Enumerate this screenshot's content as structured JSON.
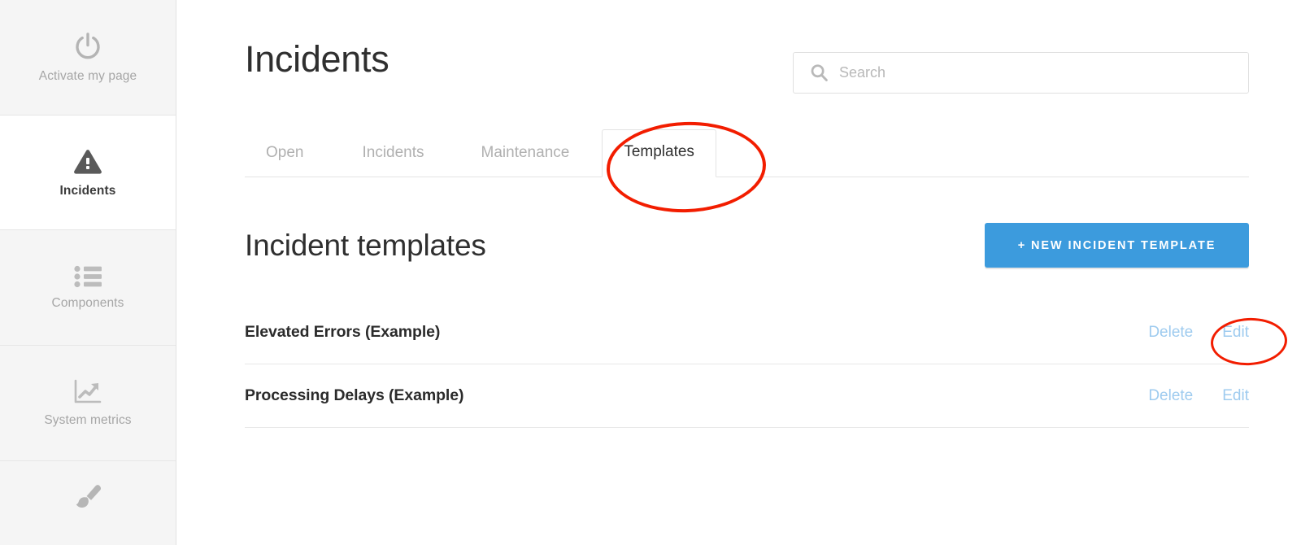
{
  "sidebar": {
    "items": [
      {
        "label": "Activate my page",
        "icon": "power-icon",
        "key": "activate",
        "active": false
      },
      {
        "label": "Incidents",
        "icon": "warning-triangle-icon",
        "key": "incidents",
        "active": true
      },
      {
        "label": "Components",
        "icon": "list-icon",
        "key": "components",
        "active": false
      },
      {
        "label": "System metrics",
        "icon": "chart-line-icon",
        "key": "metrics",
        "active": false
      },
      {
        "label": "",
        "icon": "paintbrush-icon",
        "key": "customize",
        "active": false
      }
    ]
  },
  "header": {
    "title": "Incidents"
  },
  "search": {
    "placeholder": "Search",
    "value": "",
    "icon": "search-icon"
  },
  "tabs": [
    {
      "label": "Open",
      "active": false
    },
    {
      "label": "Incidents",
      "active": false
    },
    {
      "label": "Maintenance",
      "active": false
    },
    {
      "label": "Templates",
      "active": true
    }
  ],
  "section": {
    "title": "Incident templates",
    "new_button_label": "+ New incident template"
  },
  "templates": {
    "rows": [
      {
        "name": "Elevated Errors (Example)",
        "delete_label": "Delete",
        "edit_label": "Edit"
      },
      {
        "name": "Processing Delays (Example)",
        "delete_label": "Delete",
        "edit_label": "Edit"
      }
    ]
  },
  "annotations": [
    {
      "target": "templates-tab",
      "shape": "ellipse",
      "color": "#f21d00"
    },
    {
      "target": "edit-link-row-1",
      "shape": "ellipse",
      "color": "#f21d00"
    }
  ],
  "colors": {
    "accent_blue": "#3c9bdd",
    "link_blue": "#9ecbef",
    "annotation_red": "#f21d00",
    "sidebar_inactive_bg": "#f5f5f5",
    "text_dark": "#2f2f2f",
    "text_muted": "#a6a6a6"
  }
}
